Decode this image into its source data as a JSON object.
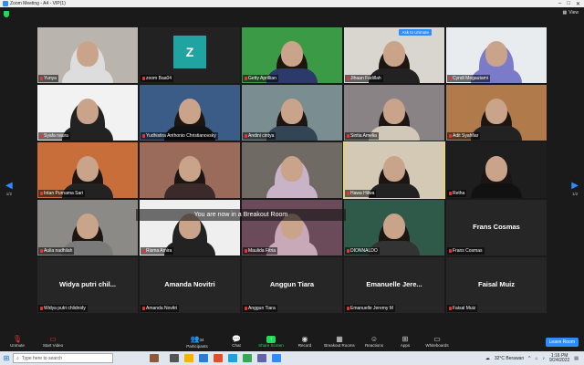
{
  "window": {
    "title": "Zoom Meeting - A4 - VIP(1)",
    "controls": [
      "–",
      "□",
      "✕"
    ]
  },
  "header": {
    "view_label": "View"
  },
  "breakout_banner": "You are now in a Breakout Room",
  "ask_to_unmute": "Ask to Unmute",
  "pagination": {
    "left": "1/2",
    "right": "1/2"
  },
  "participants": [
    {
      "name": "Yunya",
      "bg": "#b9b5ae",
      "type": "hijab",
      "cloth": "#ddd"
    },
    {
      "name": "zoom Baa04",
      "bg": "#222",
      "type": "avatar",
      "initial": "Z"
    },
    {
      "name": "Getty Aprillian",
      "bg": "#3a9a46",
      "type": "hair",
      "cloth": "#2b3a6b"
    },
    {
      "name": "Jihaan Fadillah",
      "bg": "#d9d6d0",
      "type": "hair",
      "cloth": "#222"
    },
    {
      "name": "Cyndi Megautami",
      "bg": "#e9ecef",
      "type": "hijab",
      "cloth": "#7b7bc9"
    },
    {
      "name": "Syafa naura",
      "bg": "#f2f2f2",
      "type": "hijab",
      "cloth": "#222"
    },
    {
      "name": "Yudhistira Anthonio Christianovsky",
      "bg": "#3a5c86",
      "type": "hair",
      "cloth": "#111"
    },
    {
      "name": "Andini cintya",
      "bg": "#7a8d90",
      "type": "hair",
      "cloth": "#345"
    },
    {
      "name": "Sintia Amelia",
      "bg": "#8a8386",
      "type": "hair",
      "cloth": "#d2c8b9"
    },
    {
      "name": "Adit Syahfiar",
      "bg": "#b07a4a",
      "type": "hair",
      "cloth": "#222"
    },
    {
      "name": "Intan Purnama Sari",
      "bg": "#c76e3a",
      "type": "hair",
      "cloth": "#222"
    },
    {
      "name": "",
      "bg": "#9a6a5a",
      "type": "hair",
      "cloth": "#3a2a2a"
    },
    {
      "name": "",
      "bg": "#6f6a63",
      "type": "hijab",
      "cloth": "#c9b3c8"
    },
    {
      "name": "Hawa Hilwa",
      "bg": "#d4c9b4",
      "type": "hair",
      "cloth": "#222",
      "active": true
    },
    {
      "name": "Retha",
      "bg": "#1e1e1e",
      "type": "hair",
      "cloth": "#111"
    },
    {
      "name": "Aulia nadhilah",
      "bg": "#8c8a86",
      "type": "hair",
      "cloth": "#7a7a7a"
    },
    {
      "name": "Risma Amira",
      "bg": "#efefef",
      "type": "hijab",
      "cloth": "#222"
    },
    {
      "name": "Maulida Fitria",
      "bg": "#6b4a5a",
      "type": "hijab",
      "cloth": "#c8a9b8"
    },
    {
      "name": "DIONNALDO",
      "bg": "#2f5a4a",
      "type": "hair",
      "cloth": "#333"
    },
    {
      "name": "Frans Cosmas",
      "bg": "#262626",
      "type": "name",
      "big": "Frans Cosmas"
    },
    {
      "name": "Widya putri chlidnidy",
      "bg": "#262626",
      "type": "name",
      "big": "Widya putri chil..."
    },
    {
      "name": "Amanda Novitri",
      "bg": "#262626",
      "type": "name",
      "big": "Amanda Novitri"
    },
    {
      "name": "Anggun Tiara",
      "bg": "#262626",
      "type": "name",
      "big": "Anggun Tiara"
    },
    {
      "name": "Emanuelle Jeremy M",
      "bg": "#262626",
      "type": "name",
      "big": "Emanuelle Jere..."
    },
    {
      "name": "Faisal Muiz",
      "bg": "#262626",
      "type": "name",
      "big": "Faisal Muiz"
    }
  ],
  "toolbar": {
    "unmute": "Unmute",
    "start_video": "Start Video",
    "participants": "Participants",
    "participants_count": "34",
    "chat": "Chat",
    "share_screen": "Share Screen",
    "record": "Record",
    "breakout_rooms": "Breakout Rooms",
    "reactions": "Reactions",
    "apps": "Apps",
    "whiteboards": "Whiteboards",
    "leave_room": "Leave Room"
  },
  "taskbar": {
    "search_placeholder": "Type here to search",
    "weather": "32°C  Berawan",
    "time": "1:16 PM",
    "date": "9/24/2022"
  }
}
